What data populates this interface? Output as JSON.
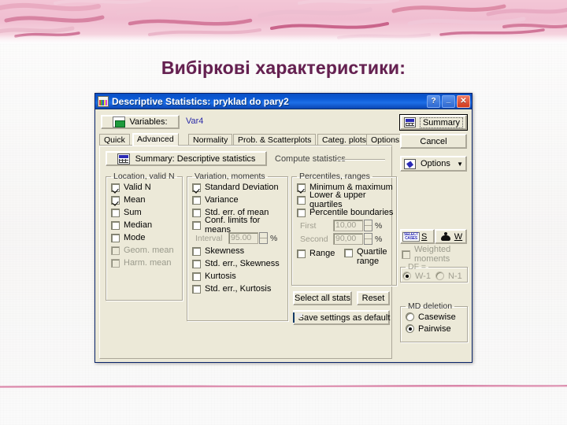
{
  "slide": {
    "title": "Вибіркові характеристики:",
    "title_color": "#642050",
    "banner_color": "#f0bed1"
  },
  "dialog": {
    "titlebar": {
      "icon": "statistica-app-icon",
      "title": "Descriptive Statistics: pryklad do pary2",
      "help_label": "?",
      "minimize_label": "_",
      "close_label": "✕"
    },
    "variables_button": "Variables:",
    "variables_value": "Var4",
    "tabs": [
      {
        "label": "Quick",
        "active": false
      },
      {
        "label": "Advanced",
        "active": true
      },
      {
        "label": "Normality",
        "active": false
      },
      {
        "label": "Prob. & Scatterplots",
        "active": false
      },
      {
        "label": "Categ. plots",
        "active": false
      },
      {
        "label": "Options",
        "active": false
      }
    ],
    "summary_stats_button": "Summary: Descriptive statistics",
    "compute_label": "Compute statistics",
    "groups": {
      "location": {
        "legend": "Location, valid N",
        "items": [
          {
            "label": "Valid N",
            "checked": true,
            "enabled": true
          },
          {
            "label": "Mean",
            "checked": true,
            "enabled": true
          },
          {
            "label": "Sum",
            "checked": false,
            "enabled": true
          },
          {
            "label": "Median",
            "checked": false,
            "enabled": true
          },
          {
            "label": "Mode",
            "checked": false,
            "enabled": true
          },
          {
            "label": "Geom. mean",
            "checked": false,
            "enabled": false
          },
          {
            "label": "Harm. mean",
            "checked": false,
            "enabled": false
          }
        ]
      },
      "variation": {
        "legend": "Variation, moments",
        "items": [
          {
            "label": "Standard Deviation",
            "checked": true,
            "enabled": true
          },
          {
            "label": "Variance",
            "checked": false,
            "enabled": true
          },
          {
            "label": "Std. err. of mean",
            "checked": false,
            "enabled": true
          },
          {
            "label": "Conf. limits for means",
            "checked": false,
            "enabled": true
          }
        ],
        "interval": {
          "label": "Interval",
          "value": "95.00",
          "unit": "%"
        },
        "items2": [
          {
            "label": "Skewness",
            "checked": false,
            "enabled": true
          },
          {
            "label": "Std. err., Skewness",
            "checked": false,
            "enabled": true
          },
          {
            "label": "Kurtosis",
            "checked": false,
            "enabled": true
          },
          {
            "label": "Std. err., Kurtosis",
            "checked": false,
            "enabled": true
          }
        ]
      },
      "percentiles": {
        "legend": "Percentiles, ranges",
        "items": [
          {
            "label": "Minimum & maximum",
            "checked": true,
            "enabled": true
          },
          {
            "label": "Lower & upper quartiles",
            "checked": false,
            "enabled": true
          },
          {
            "label": "Percentile boundaries",
            "checked": false,
            "enabled": true
          }
        ],
        "first": {
          "label": "First",
          "value": "10,00",
          "unit": "%"
        },
        "second": {
          "label": "Second",
          "value": "90,00",
          "unit": "%"
        },
        "range_label": "Range",
        "quartile_range_label": "Quartile range"
      }
    },
    "select_all_stats_button": "Select all stats",
    "reset_button": "Reset",
    "save_settings_button": "Save settings as default",
    "right_panel": {
      "summary_button": "Summary",
      "cancel_button": "Cancel",
      "options_button": "Options",
      "options_arrow": "▼",
      "select_cases_button": "SELECT CASES",
      "select_cases_key": "S",
      "weights_button_key": "W",
      "weighted_moments": {
        "label": "Weighted moments",
        "checked": false,
        "enabled": false
      },
      "df_group": {
        "legend": "DF =",
        "options": [
          {
            "label": "W-1",
            "selected": true,
            "enabled": false
          },
          {
            "label": "N-1",
            "selected": false,
            "enabled": false
          }
        ]
      },
      "md_group": {
        "legend": "MD deletion",
        "options": [
          {
            "label": "Casewise",
            "selected": false,
            "enabled": true
          },
          {
            "label": "Pairwise",
            "selected": true,
            "enabled": true
          }
        ]
      }
    }
  }
}
